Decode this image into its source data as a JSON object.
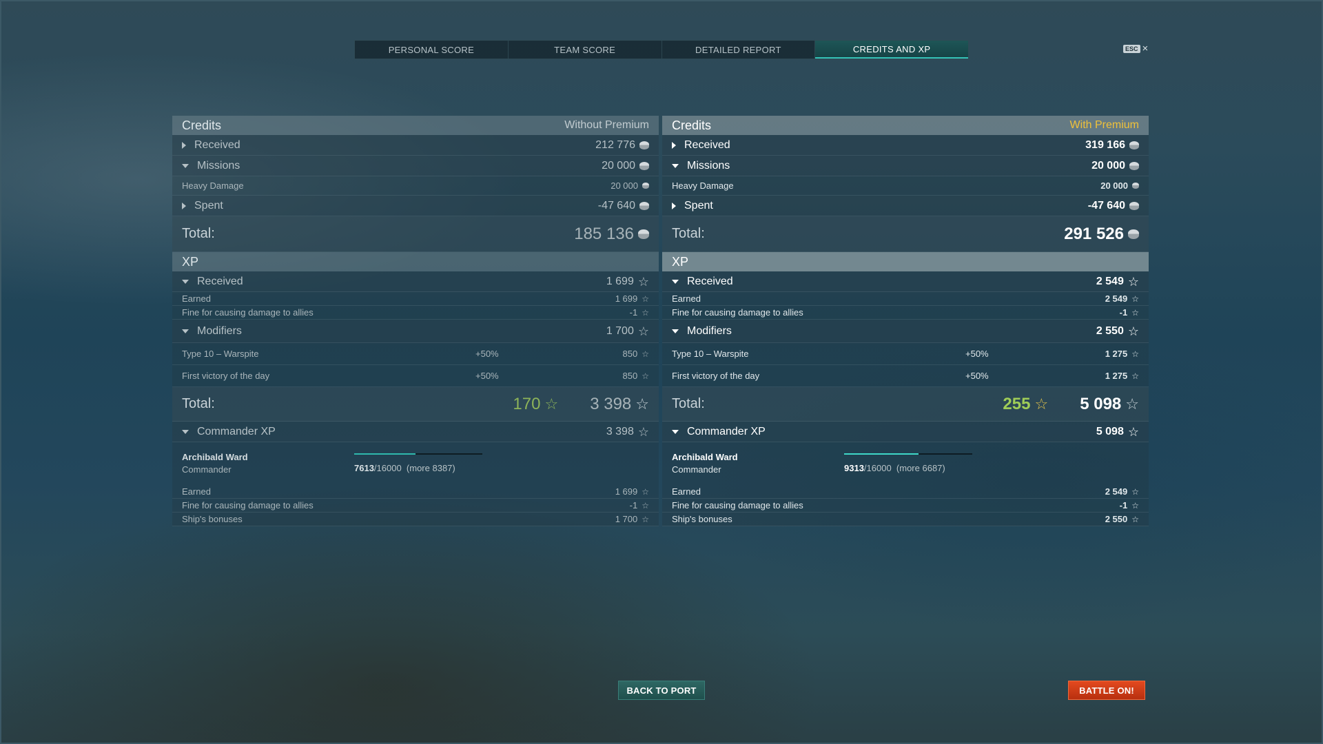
{
  "tabs": [
    {
      "label": "PERSONAL SCORE"
    },
    {
      "label": "TEAM SCORE"
    },
    {
      "label": "DETAILED REPORT"
    },
    {
      "label": "CREDITS AND XP",
      "active": true
    }
  ],
  "esc": {
    "key": "ESC",
    "close": "×"
  },
  "left": {
    "credits": {
      "title": "Credits",
      "subtitle": "Without Premium",
      "received": {
        "label": "Received",
        "value": "212 776"
      },
      "missions": {
        "label": "Missions",
        "value": "20 000"
      },
      "heavy_damage": {
        "label": "Heavy Damage",
        "value": "20 000"
      },
      "spent": {
        "label": "Spent",
        "value": "-47 640"
      },
      "total": {
        "label": "Total:",
        "value": "185 136"
      }
    },
    "xp": {
      "title": "XP",
      "received": {
        "label": "Received",
        "value": "1 699"
      },
      "earned": {
        "label": "Earned",
        "value": "1 699"
      },
      "fine": {
        "label": "Fine for causing damage to allies",
        "value": "-1"
      },
      "modifiers": {
        "label": "Modifiers",
        "value": "1 700"
      },
      "mod1": {
        "label": "Type 10 – Warspite",
        "pct": "+50%",
        "value": "850"
      },
      "mod2": {
        "label": "First victory of the day",
        "pct": "+50%",
        "value": "850"
      },
      "total": {
        "label": "Total:",
        "free": "170",
        "value": "3 398"
      }
    },
    "commander": {
      "label": "Commander XP",
      "value": "3 398",
      "name": "Archibald Ward",
      "rank": "Commander",
      "progress_current": "7613",
      "progress_max": "/16000",
      "progress_more": "(more 8387)",
      "progress_fraction": 0.476,
      "earned": {
        "label": "Earned",
        "value": "1 699"
      },
      "fine": {
        "label": "Fine for causing damage to allies",
        "value": "-1"
      },
      "bonuses": {
        "label": "Ship's bonuses",
        "value": "1 700"
      }
    }
  },
  "right": {
    "credits": {
      "title": "Credits",
      "subtitle": "With Premium",
      "received": {
        "label": "Received",
        "value": "319 166"
      },
      "missions": {
        "label": "Missions",
        "value": "20 000"
      },
      "heavy_damage": {
        "label": "Heavy Damage",
        "value": "20 000"
      },
      "spent": {
        "label": "Spent",
        "value": "-47 640"
      },
      "total": {
        "label": "Total:",
        "value": "291 526"
      }
    },
    "xp": {
      "title": "XP",
      "received": {
        "label": "Received",
        "value": "2 549"
      },
      "earned": {
        "label": "Earned",
        "value": "2 549"
      },
      "fine": {
        "label": "Fine for causing damage to allies",
        "value": "-1"
      },
      "modifiers": {
        "label": "Modifiers",
        "value": "2 550"
      },
      "mod1": {
        "label": "Type 10 – Warspite",
        "pct": "+50%",
        "value": "1 275"
      },
      "mod2": {
        "label": "First victory of the day",
        "pct": "+50%",
        "value": "1 275"
      },
      "total": {
        "label": "Total:",
        "free": "255",
        "value": "5 098"
      }
    },
    "commander": {
      "label": "Commander XP",
      "value": "5 098",
      "name": "Archibald Ward",
      "rank": "Commander",
      "progress_current": "9313",
      "progress_max": "/16000",
      "progress_more": "(more 6687)",
      "progress_fraction": 0.582,
      "earned": {
        "label": "Earned",
        "value": "2 549"
      },
      "fine": {
        "label": "Fine for causing damage to allies",
        "value": "-1"
      },
      "bonuses": {
        "label": "Ship's bonuses",
        "value": "2 550"
      }
    }
  },
  "buttons": {
    "back_to_port": "BACK TO PORT",
    "battle_on": "BATTLE ON!"
  },
  "colors": {
    "accent_teal": "#34c3b7",
    "premium_gold": "#f0c23a",
    "free_xp_green": "#9fcd57",
    "battle_orange": "#d03c15"
  },
  "icons": {
    "credits": "credits-coin-icon",
    "xp": "star-icon",
    "expand": "chevron-right-icon",
    "collapse": "chevron-down-icon"
  }
}
